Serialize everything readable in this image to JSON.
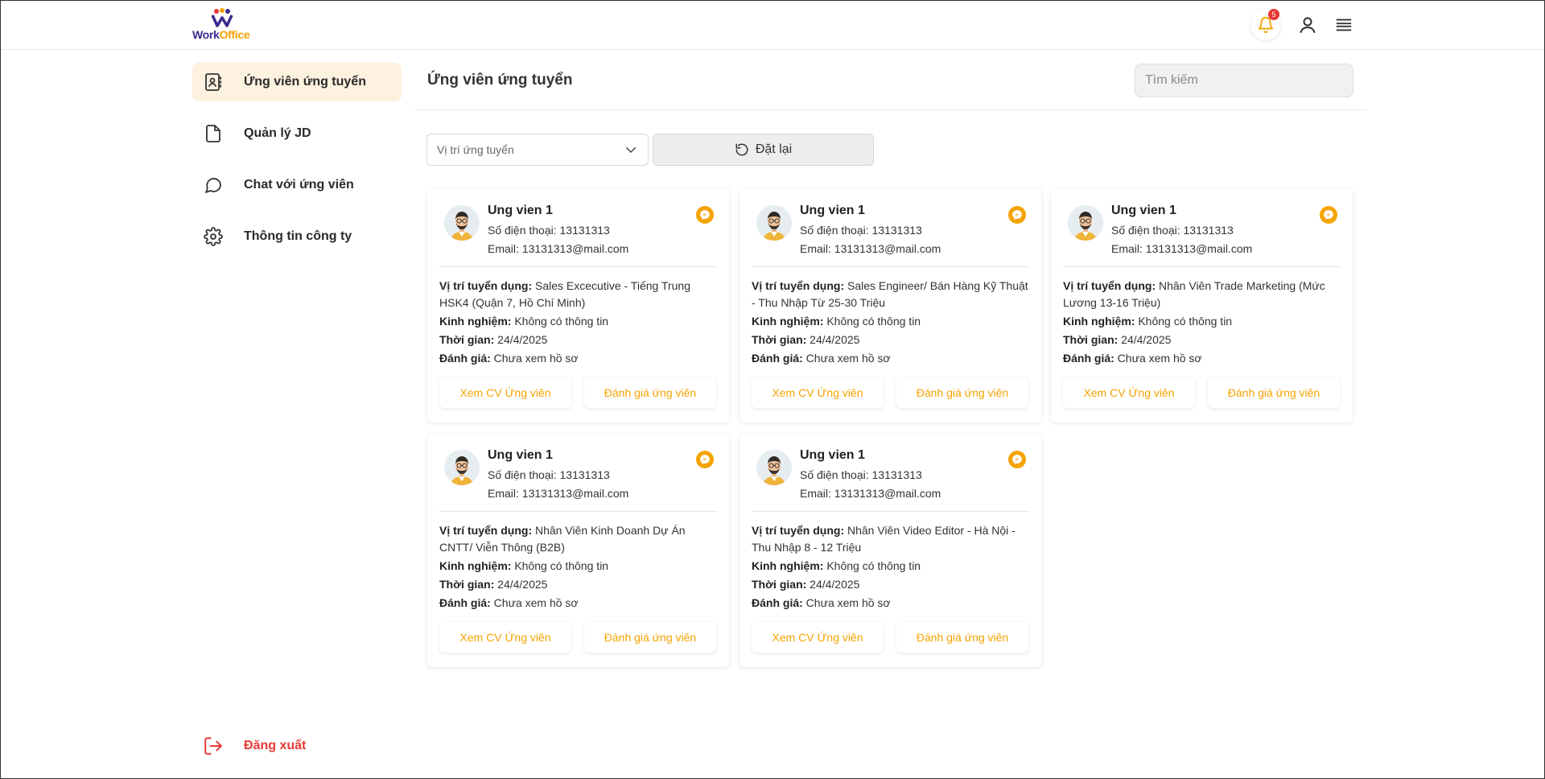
{
  "header": {
    "logo_word1": "Work",
    "logo_word2": "Office",
    "notification_count": "5"
  },
  "sidebar": {
    "items": [
      {
        "label": "Ứng viên ứng tuyển",
        "icon": "contact-book-icon"
      },
      {
        "label": "Quản lý JD",
        "icon": "document-icon"
      },
      {
        "label": "Chat với ứng viên",
        "icon": "chat-bubble-icon"
      },
      {
        "label": "Thông tin công ty",
        "icon": "gear-icon"
      }
    ],
    "logout_label": "Đăng xuất"
  },
  "main": {
    "title": "Ứng viên ứng tuyển",
    "search_placeholder": "Tìm kiếm",
    "position_select_value": "Vị trí ứng tuyển",
    "reset_label": "Đặt lại"
  },
  "labels": {
    "phone": "Số điện thoại:",
    "email": "Email:",
    "position": "Vị trí tuyển dụng:",
    "experience": "Kinh nghiệm:",
    "time": "Thời gian:",
    "rating": "Đánh giá:",
    "view_cv": "Xem CV Ứng viên",
    "rate_candidate": "Đánh giá ứng viên"
  },
  "candidates": [
    {
      "name": "Ung vien 1",
      "phone": "13131313",
      "email": "13131313@mail.com",
      "position": "Sales Excecutive - Tiếng Trung HSK4 (Quận 7, Hồ Chí Minh)",
      "experience": "Không có thông tin",
      "time": "24/4/2025",
      "rating": "Chưa xem hồ sơ"
    },
    {
      "name": "Ung vien 1",
      "phone": "13131313",
      "email": "13131313@mail.com",
      "position": "Sales Engineer/ Bán Hàng Kỹ Thuật - Thu Nhập Từ 25-30 Triệu",
      "experience": "Không có thông tin",
      "time": "24/4/2025",
      "rating": "Chưa xem hồ sơ"
    },
    {
      "name": "Ung vien 1",
      "phone": "13131313",
      "email": "13131313@mail.com",
      "position": "Nhân Viên Trade Marketing (Mức Lương 13-16 Triệu)",
      "experience": "Không có thông tin",
      "time": "24/4/2025",
      "rating": "Chưa xem hồ sơ"
    },
    {
      "name": "Ung vien 1",
      "phone": "13131313",
      "email": "13131313@mail.com",
      "position": "Nhân Viên Kinh Doanh Dự Án CNTT/ Viễn Thông (B2B)",
      "experience": "Không có thông tin",
      "time": "24/4/2025",
      "rating": "Chưa xem hồ sơ"
    },
    {
      "name": "Ung vien 1",
      "phone": "13131313",
      "email": "13131313@mail.com",
      "position": "Nhân Viên Video Editor - Hà Nội - Thu Nhập 8 - 12 Triệu",
      "experience": "Không có thông tin",
      "time": "24/4/2025",
      "rating": "Chưa xem hồ sơ"
    }
  ],
  "colors": {
    "accent": "#f5a300",
    "active_bg": "#fdf1e0",
    "logout": "#e53935",
    "badge": "#e53935"
  }
}
